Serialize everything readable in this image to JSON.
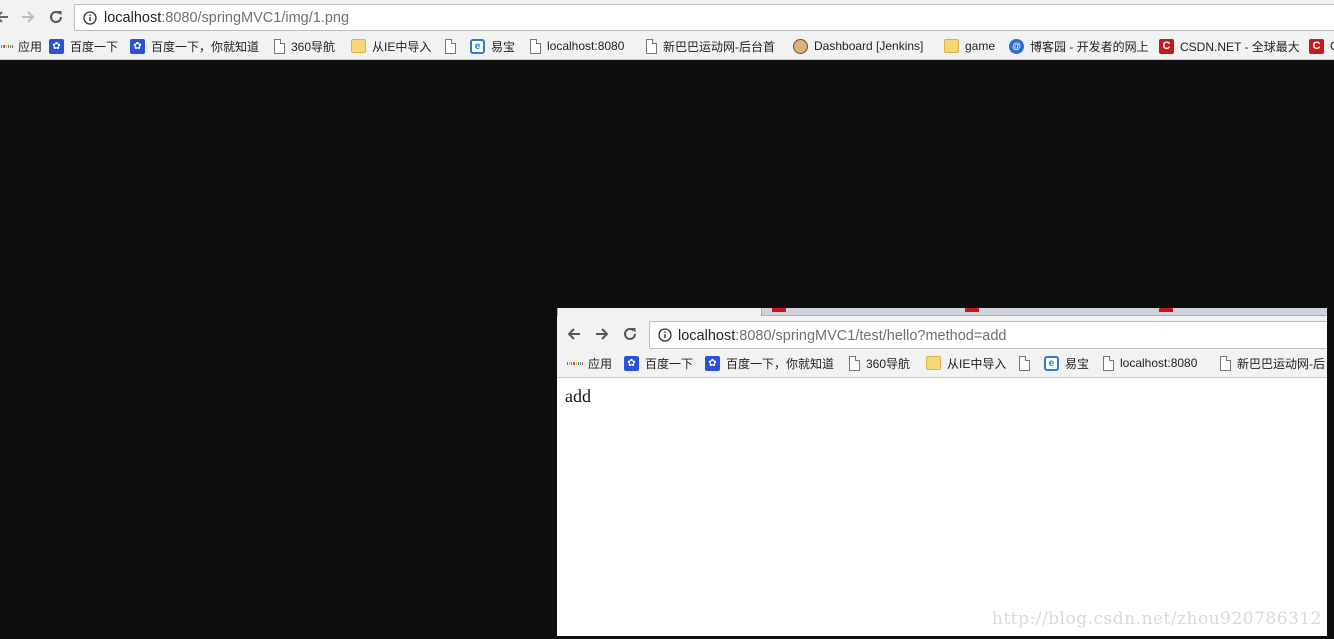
{
  "outer": {
    "url_host": "localhost",
    "url_path": ":8080/springMVC1/img/1.png",
    "bookmarks": [
      {
        "label": "应用",
        "icon": "apps-grid-icon"
      },
      {
        "label": "百度一下",
        "icon": "baidu-paw-icon"
      },
      {
        "label": "百度一下，你就知道",
        "icon": "baidu-paw-icon"
      },
      {
        "label": "360导航",
        "icon": "page-icon"
      },
      {
        "label": "从IE中导入",
        "icon": "folder-icon"
      },
      {
        "label": "",
        "icon": "page-icon"
      },
      {
        "label": "易宝",
        "icon": "ie-icon"
      },
      {
        "label": "localhost:8080",
        "icon": "page-icon"
      },
      {
        "label": "新巴巴运动网-后台首",
        "icon": "page-icon"
      },
      {
        "label": "Dashboard [Jenkins]",
        "icon": "jenkins-icon"
      },
      {
        "label": "game",
        "icon": "folder-icon"
      },
      {
        "label": "博客园 - 开发者的网上",
        "icon": "cnblogs-icon"
      },
      {
        "label": "CSDN.NET - 全球最大",
        "icon": "csdn-icon"
      },
      {
        "label": "C",
        "icon": "csdn-icon"
      }
    ]
  },
  "inner": {
    "url_host": "localhost",
    "url_path": ":8080/springMVC1/test/hello?method=add",
    "bookmarks": [
      {
        "label": "应用",
        "icon": "apps-grid-icon"
      },
      {
        "label": "百度一下",
        "icon": "baidu-paw-icon"
      },
      {
        "label": "百度一下，你就知道",
        "icon": "baidu-paw-icon"
      },
      {
        "label": "360导航",
        "icon": "page-icon"
      },
      {
        "label": "从IE中导入",
        "icon": "folder-icon"
      },
      {
        "label": "",
        "icon": "page-icon"
      },
      {
        "label": "易宝",
        "icon": "ie-icon"
      },
      {
        "label": "localhost:8080",
        "icon": "page-icon"
      },
      {
        "label": "新巴巴运动网-后",
        "icon": "page-icon"
      }
    ],
    "page_text": "add"
  },
  "watermark": "http://blog.csdn.net/zhou920786312",
  "colors": {
    "desktop_background": "#0e0e0e",
    "chrome_background": "#f2f2f2",
    "csdn_red": "#c9171e",
    "baidu_blue": "#2a51d8"
  }
}
